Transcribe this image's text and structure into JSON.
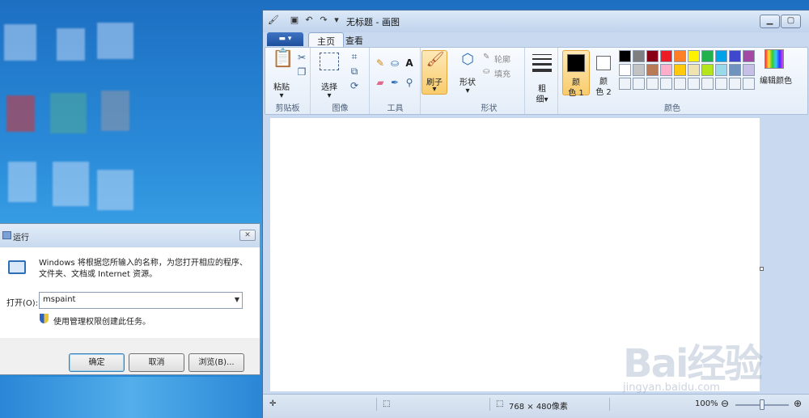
{
  "paint": {
    "title": "无标题 - 画图",
    "tabs": [
      "主页",
      "查看"
    ],
    "groups": {
      "clipboard": {
        "label": "剪贴板",
        "paste": "粘贴"
      },
      "image": {
        "label": "图像",
        "select": "选择"
      },
      "tools": {
        "label": "工具"
      },
      "brushes": {
        "label": "刷子"
      },
      "shapes": {
        "label": "形状",
        "shapes_btn": "形状",
        "outline": "轮廓",
        "fill": "填充"
      },
      "size": {
        "label_a": "粗",
        "label_b": "细"
      },
      "colors": {
        "label": "颜色",
        "color1_a": "颜",
        "color1_b": "色 1",
        "color2_a": "颜",
        "color2_b": "色 2",
        "edit": "编辑颜色",
        "palette_row1": [
          "#000000",
          "#7f7f7f",
          "#880015",
          "#ed1c24",
          "#ff7f27",
          "#fff200",
          "#22b14c",
          "#00a2e8",
          "#3f48cc",
          "#a349a4"
        ],
        "palette_row2": [
          "#ffffff",
          "#c3c3c3",
          "#b97a57",
          "#ffaec9",
          "#ffc90e",
          "#efe4b0",
          "#b5e61d",
          "#99d9ea",
          "#7092be",
          "#c8bfe7"
        ]
      }
    },
    "status": {
      "dimensions": "768 × 480像素",
      "zoom": "100%"
    }
  },
  "run": {
    "title": "运行",
    "description": "Windows 将根据您所输入的名称，为您打开相应的程序、文件夹、文档或 Internet 资源。",
    "open_label": "打开(O):",
    "open_value": "mspaint",
    "admin_note": "使用管理权限创建此任务。",
    "buttons": {
      "ok": "确定",
      "cancel": "取消",
      "browse": "浏览(B)..."
    }
  },
  "watermark": {
    "brand": "Bai经验",
    "url": "jingyan.baidu.com"
  }
}
